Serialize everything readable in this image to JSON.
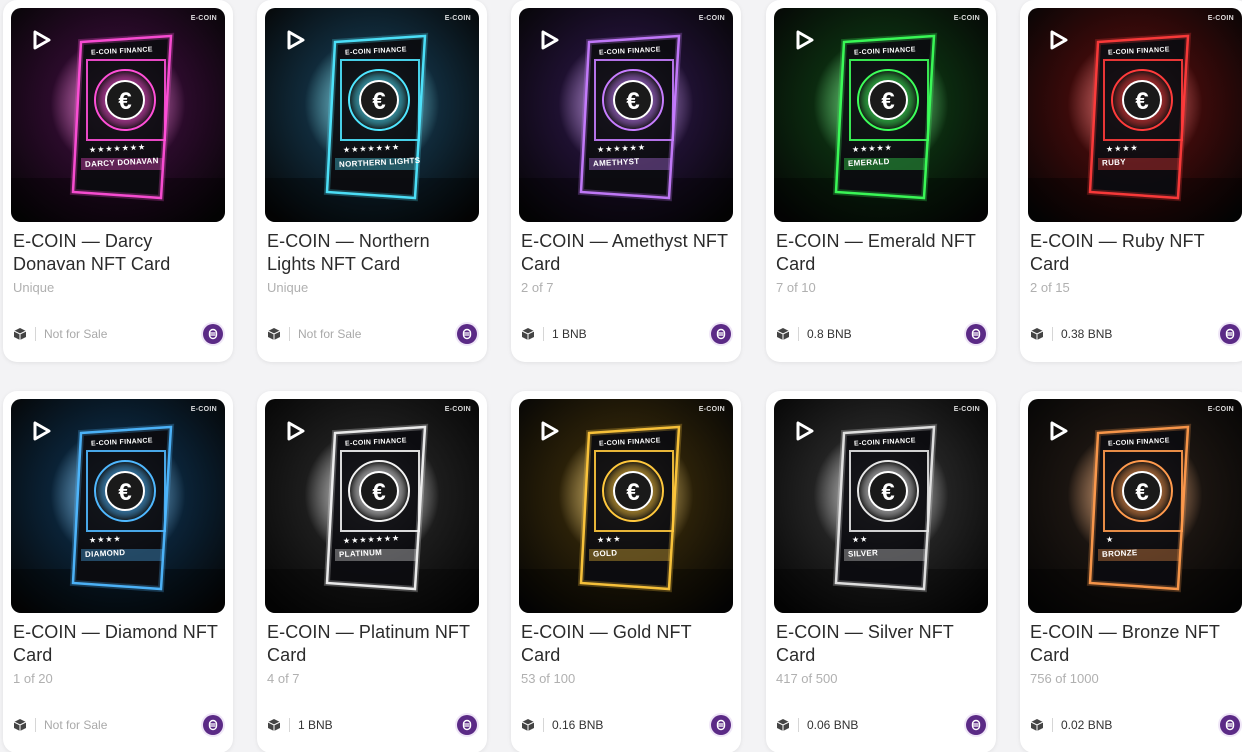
{
  "cards": [
    {
      "title": "E-COIN — Darcy Donavan NFT Card",
      "edition": "Unique",
      "price": "Not for Sale",
      "for_sale": false,
      "card_name": "DARCY DONAVAN",
      "accent": "#ff4fd8",
      "bg": "#2a0a2a",
      "stars": "★★★★★★★"
    },
    {
      "title": "E-COIN — Northern Lights NFT Card",
      "edition": "Unique",
      "price": "Not for Sale",
      "for_sale": false,
      "card_name": "NORTHERN LIGHTS",
      "accent": "#4fe6ff",
      "bg": "#102a3a",
      "stars": "★★★★★★★"
    },
    {
      "title": "E-COIN — Amethyst NFT Card",
      "edition": "2 of 7",
      "price": "1 BNB",
      "for_sale": true,
      "card_name": "AMETHYST",
      "accent": "#c77dff",
      "bg": "#1e1030",
      "stars": "★★★★★★"
    },
    {
      "title": "E-COIN — Emerald NFT Card",
      "edition": "7 of 10",
      "price": "0.8 BNB",
      "for_sale": true,
      "card_name": "EMERALD",
      "accent": "#3dff5a",
      "bg": "#0b2a0f",
      "stars": "★★★★★"
    },
    {
      "title": "E-COIN — Ruby NFT Card",
      "edition": "2 of 15",
      "price": "0.38 BNB",
      "for_sale": true,
      "card_name": "RUBY",
      "accent": "#ff3b3b",
      "bg": "#3a0a0a",
      "stars": "★★★★"
    },
    {
      "title": "E-COIN — Diamond NFT Card",
      "edition": "1 of 20",
      "price": "Not for Sale",
      "for_sale": false,
      "card_name": "DIAMOND",
      "accent": "#4fb8ff",
      "bg": "#0a2236",
      "stars": "★★★★"
    },
    {
      "title": "E-COIN — Platinum NFT Card",
      "edition": "4 of 7",
      "price": "1 BNB",
      "for_sale": true,
      "card_name": "PLATINUM",
      "accent": "#f2f2f2",
      "bg": "#1c1c1c",
      "stars": "★★★★★★★"
    },
    {
      "title": "E-COIN — Gold NFT Card",
      "edition": "53 of 100",
      "price": "0.16 BNB",
      "for_sale": true,
      "card_name": "GOLD",
      "accent": "#ffc83d",
      "bg": "#2a2008",
      "stars": "★★★"
    },
    {
      "title": "E-COIN — Silver NFT Card",
      "edition": "417 of 500",
      "price": "0.06 BNB",
      "for_sale": true,
      "card_name": "SILVER",
      "accent": "#e6e6e6",
      "bg": "#222222",
      "stars": "★★"
    },
    {
      "title": "E-COIN — Bronze NFT Card",
      "edition": "756 of 1000",
      "price": "0.02 BNB",
      "for_sale": true,
      "card_name": "BRONZE",
      "accent": "#ff9a4d",
      "bg": "#1a1410",
      "stars": "★"
    }
  ],
  "brand": "E-COIN",
  "card_header": "E-COIN FINANCE",
  "colors": {
    "coin_badge": "#5b2a86",
    "title_text": "#2b2b2b",
    "edition_text": "#b0b0b0"
  },
  "icons": {
    "play": "play-icon",
    "collection": "cube-icon",
    "currency": "ecoin-badge-icon"
  }
}
